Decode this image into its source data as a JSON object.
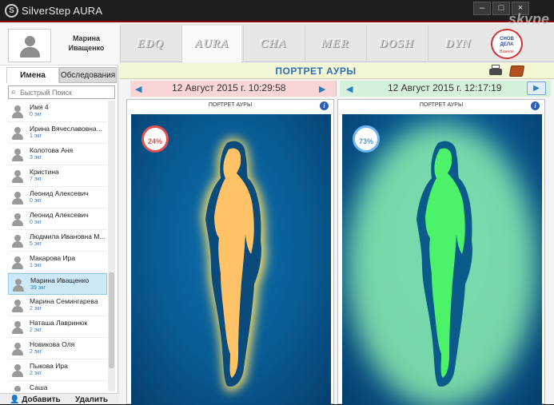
{
  "app": {
    "title": "SilverStep AURA",
    "logo_letter": "S",
    "window_controls": [
      "–",
      "□",
      "×"
    ],
    "overlay": "skype"
  },
  "profile": {
    "name_line1": "Марина",
    "name_line2": "Иващенко"
  },
  "left_tabs": [
    "Имена",
    "Обследования"
  ],
  "search": {
    "placeholder": "Быстрый Поиск"
  },
  "people": [
    {
      "name": "Имя 4",
      "count": "0 экг"
    },
    {
      "name": "Ирина Вячеславовна...",
      "count": "1 экг"
    },
    {
      "name": "Колотова Аня",
      "count": "3 экг"
    },
    {
      "name": "Кристина",
      "count": "7 экг"
    },
    {
      "name": "Леонид Алексевич",
      "count": "0 экг"
    },
    {
      "name": "Леонид Алексевич",
      "count": "0 экг"
    },
    {
      "name": "Людмила Ивановна М...",
      "count": "5 экг"
    },
    {
      "name": "Макарова Ира",
      "count": "1 экг"
    },
    {
      "name": "Марина Иващенко",
      "count": "39 экг",
      "selected": true
    },
    {
      "name": "Марина Семингарева",
      "count": "2 экг"
    },
    {
      "name": "Наташа Лавринюк",
      "count": "2 экг"
    },
    {
      "name": "Новикова Оля",
      "count": "2 экг"
    },
    {
      "name": "Пыкова Ира",
      "count": "2 экг"
    },
    {
      "name": "Саша",
      "count": ""
    }
  ],
  "left_footer": {
    "add_label": "Добавить",
    "delete_label": "Удалить"
  },
  "main_tabs": [
    "EDQ",
    "AURA",
    "CHA",
    "MER",
    "DOSH",
    "DYN"
  ],
  "active_tab": "AURA",
  "brand": {
    "line1": "СНОВ ДЕЛА",
    "line2": "Важное"
  },
  "header": {
    "title": "ПОРТРЕТ АУРЫ"
  },
  "left_date": {
    "text": "12 Август 2015 г. 10:29:58"
  },
  "right_date": {
    "text": "12 Август 2015 г. 12:17:19"
  },
  "panels": [
    {
      "title": "ПОРТРЕТ АУРЫ",
      "percent": "24%",
      "percent_color": "#e05050",
      "aura_color": "#ffe066",
      "figure_color": "#ffc266",
      "level": 0.24
    },
    {
      "title": "ПОРТРЕТ АУРЫ",
      "percent": "73%",
      "percent_color": "#4a9be0",
      "aura_color": "#9dffb0",
      "figure_color": "#4cf26a",
      "level": 0.73
    }
  ],
  "colors": {
    "accent": "#2b7ec2",
    "title_red": "#8b0000",
    "selection": "#cde9f6"
  }
}
